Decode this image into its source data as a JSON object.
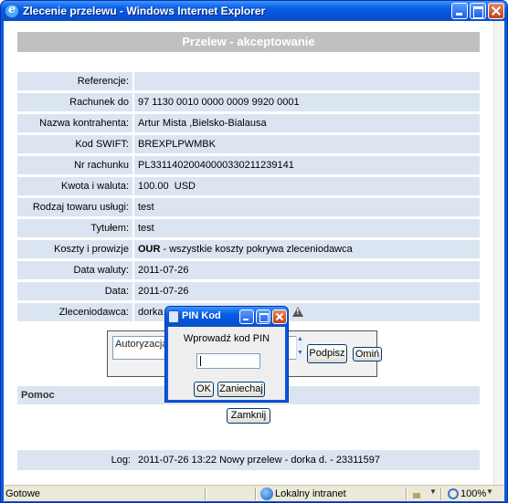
{
  "window": {
    "title": "Zlecenie przelewu - Windows Internet Explorer"
  },
  "page": {
    "header": "Przelew - akceptowanie",
    "rows": [
      {
        "label": "Referencje:",
        "value": ""
      },
      {
        "label": "Rachunek do obciążenia:",
        "value": "97 1130 0010 0000 0009 9920 0001"
      },
      {
        "label": "Nazwa kontrahenta:",
        "value": "Artur Mista ,Bielsko-Bialausa"
      },
      {
        "label": "Kod SWIFT:",
        "value": "BREXPLPWMBK"
      },
      {
        "label": "Nr rachunku kontrahenta:",
        "value": "PL33114020040000330211239141"
      },
      {
        "label": "Kwota i waluta:",
        "value": "100.00  USD"
      },
      {
        "label": "Rodzaj towaru usługi:",
        "value": "test"
      },
      {
        "label": "Tytułem:",
        "value": "test"
      },
      {
        "label": "Koszty i prowizje pokrywa:",
        "value_bold": "OUR",
        "value": " - wszystkie koszty pokrywa zleceniodawca"
      },
      {
        "label": "Data waluty:",
        "value": "2011-07-26"
      },
      {
        "label": "Data:",
        "value": "2011-07-26"
      },
      {
        "label": "Zleceniodawca:",
        "value": "dorka d"
      }
    ],
    "authorization": {
      "text": "Autoryzacja uz",
      "sign_button": "Podpisz",
      "skip_button": "Omiń"
    },
    "help_label": "Pomoc",
    "close_button": "Zamknij",
    "log": {
      "label": "Log:",
      "value": "2011-07-26 13:22 Nowy przelew - dorka d. - 23311597"
    }
  },
  "dialog": {
    "title": "PIN Kod",
    "prompt": "Wprowadź kod PIN",
    "pin_value": "",
    "ok_button": "OK",
    "cancel_button": "Zaniechaj"
  },
  "statusbar": {
    "status": "Gotowe",
    "zone": "Lokalny intranet",
    "zoom": "100%"
  }
}
